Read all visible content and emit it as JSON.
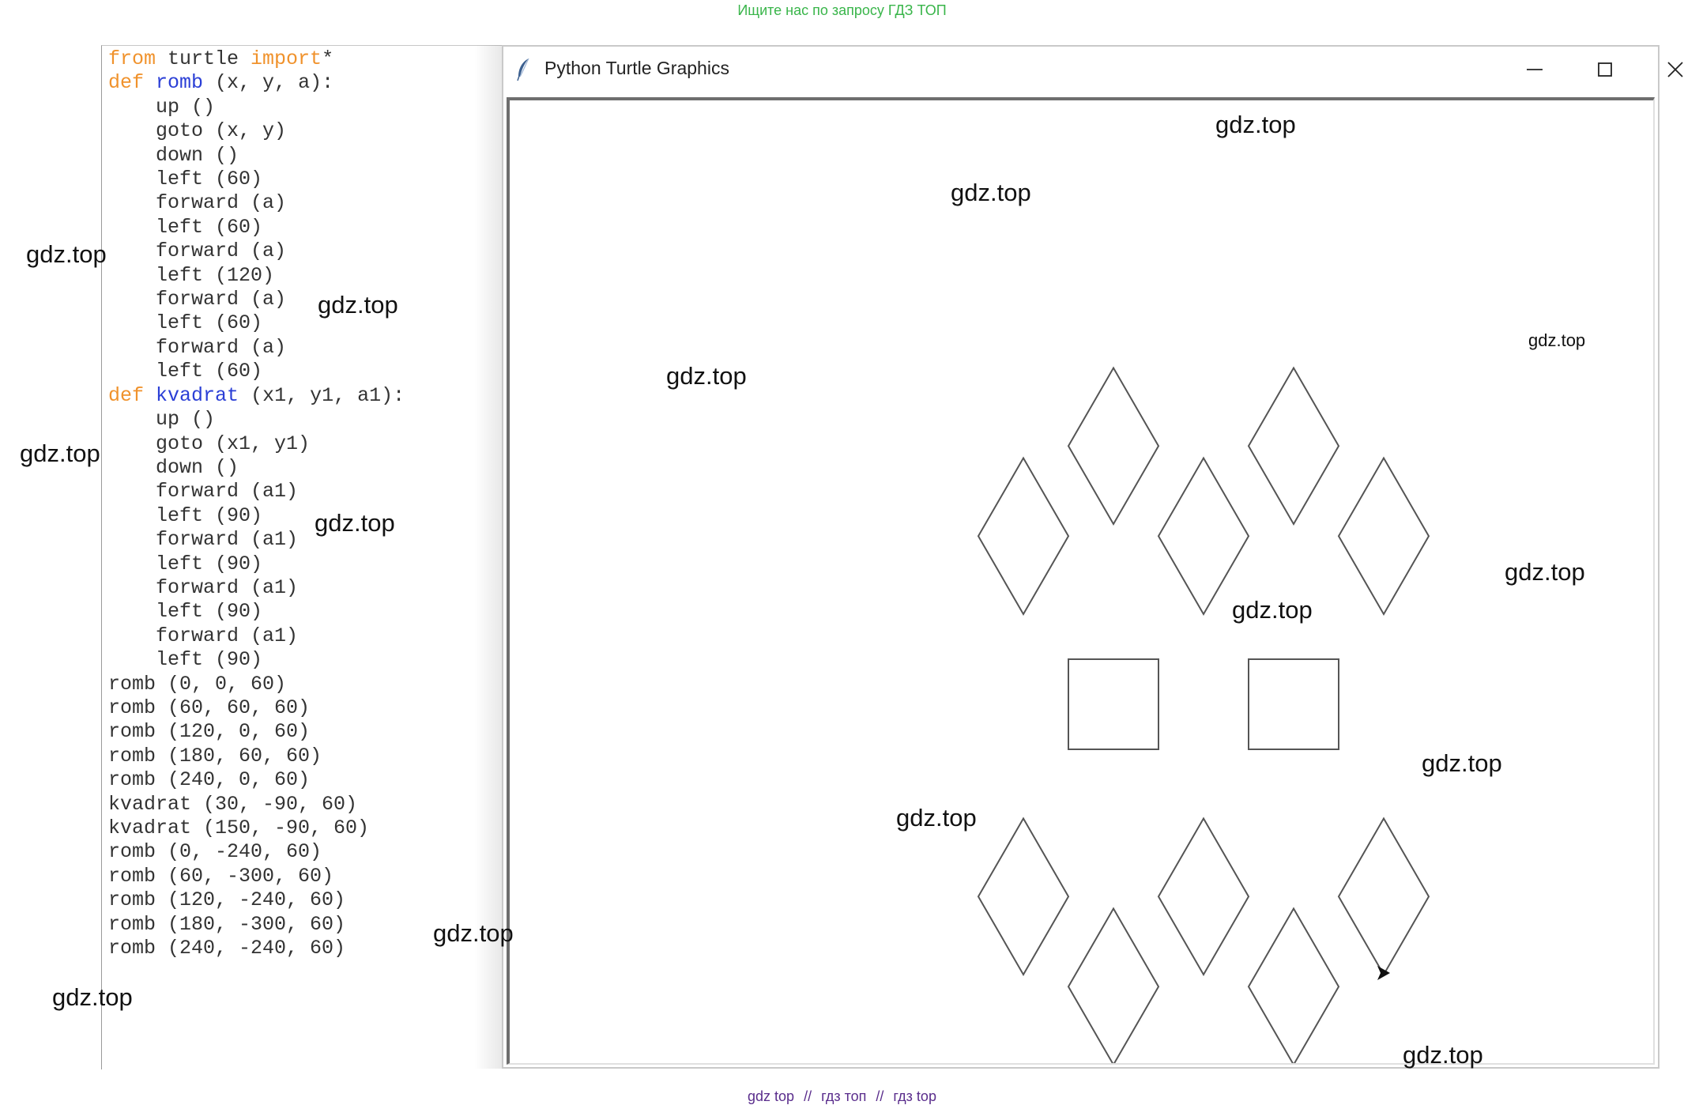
{
  "top_banner": "Ищите нас по запросу ГДЗ ТОП",
  "bottom_banner": [
    "gdz top",
    "//",
    "гдз топ",
    "//",
    "гдз top"
  ],
  "window": {
    "title": "Python Turtle Graphics",
    "icon": "feather-icon",
    "minimize_icon": "minimize-icon",
    "maximize_icon": "maximize-icon",
    "close_icon": "close-icon"
  },
  "code": [
    [
      {
        "t": "from",
        "c": "kw"
      },
      {
        "t": " turtle "
      },
      {
        "t": "import",
        "c": "kw"
      },
      {
        "t": "*"
      }
    ],
    [
      {
        "t": "def",
        "c": "kw"
      },
      {
        "t": " "
      },
      {
        "t": "romb",
        "c": "fn"
      },
      {
        "t": " (x, y, a):"
      }
    ],
    [
      {
        "t": "    up ()"
      }
    ],
    [
      {
        "t": "    goto (x, y)"
      }
    ],
    [
      {
        "t": "    down ()"
      }
    ],
    [
      {
        "t": "    left (60)"
      }
    ],
    [
      {
        "t": "    forward (a)"
      }
    ],
    [
      {
        "t": "    left (60)"
      }
    ],
    [
      {
        "t": "    forward (a)"
      }
    ],
    [
      {
        "t": "    left (120)"
      }
    ],
    [
      {
        "t": "    forward (a)"
      }
    ],
    [
      {
        "t": "    left (60)"
      }
    ],
    [
      {
        "t": "    forward (a)"
      }
    ],
    [
      {
        "t": "    left (60)"
      }
    ],
    [
      {
        "t": "def",
        "c": "kw"
      },
      {
        "t": " "
      },
      {
        "t": "kvadrat",
        "c": "fn"
      },
      {
        "t": " (x1, y1, a1):"
      }
    ],
    [
      {
        "t": "    up ()"
      }
    ],
    [
      {
        "t": "    goto (x1, y1)"
      }
    ],
    [
      {
        "t": "    down ()"
      }
    ],
    [
      {
        "t": "    forward (a1)"
      }
    ],
    [
      {
        "t": "    left (90)"
      }
    ],
    [
      {
        "t": "    forward (a1)"
      }
    ],
    [
      {
        "t": "    left (90)"
      }
    ],
    [
      {
        "t": "    forward (a1)"
      }
    ],
    [
      {
        "t": "    left (90)"
      }
    ],
    [
      {
        "t": "    forward (a1)"
      }
    ],
    [
      {
        "t": "    left (90)"
      }
    ],
    [
      {
        "t": "romb (0, 0, 60)"
      }
    ],
    [
      {
        "t": "romb (60, 60, 60)"
      }
    ],
    [
      {
        "t": "romb (120, 0, 60)"
      }
    ],
    [
      {
        "t": "romb (180, 60, 60)"
      }
    ],
    [
      {
        "t": "romb (240, 0, 60)"
      }
    ],
    [
      {
        "t": "kvadrat (30, -90, 60)"
      }
    ],
    [
      {
        "t": "kvadrat (150, -90, 60)"
      }
    ],
    [
      {
        "t": "romb (0, -240, 60)"
      }
    ],
    [
      {
        "t": "romb (60, -300, 60)"
      }
    ],
    [
      {
        "t": "romb (120, -240, 60)"
      }
    ],
    [
      {
        "t": "romb (180, -300, 60)"
      }
    ],
    [
      {
        "t": "romb (240, -240, 60)"
      }
    ]
  ],
  "drawing": {
    "stroke_color": "#555555",
    "rhombi": [
      [
        0,
        0
      ],
      [
        60,
        60
      ],
      [
        120,
        0
      ],
      [
        180,
        60
      ],
      [
        240,
        0
      ],
      [
        0,
        -240
      ],
      [
        60,
        -300
      ],
      [
        120,
        -240
      ],
      [
        180,
        -300
      ],
      [
        240,
        -240
      ]
    ],
    "squares": [
      [
        30,
        -90
      ],
      [
        150,
        -90
      ]
    ],
    "side": 60,
    "turtle_icon": "arrow-cursor-icon"
  },
  "watermarks": {
    "w1": "gdz.top",
    "w2": "gdz.top",
    "w3": "gdz.top",
    "w4": "gdz.top",
    "w5": "gdz.top",
    "w6": "gdz.top",
    "w7": "gdz.top",
    "w8": "gdz.top",
    "w9": "gdz.top",
    "w10": "gdz.top",
    "w11": "gdz.top",
    "w12": "gdz.top",
    "w13": "gdz.top",
    "w14": "gdz.top",
    "w15": "gdz.top"
  }
}
